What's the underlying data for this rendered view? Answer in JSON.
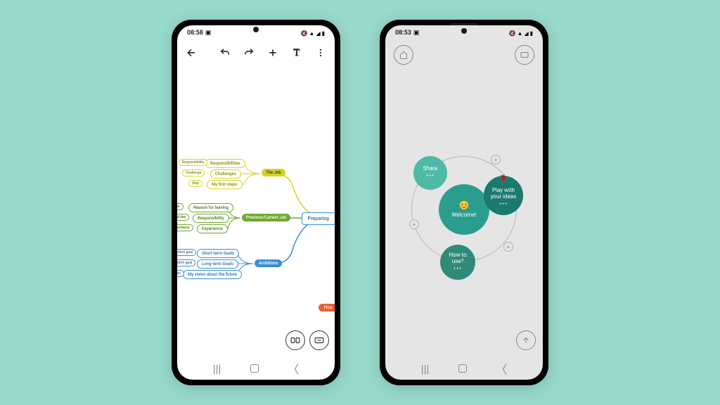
{
  "phoneLeft": {
    "status": {
      "time": "08:58",
      "indicators": "📷",
      "right": "🔇 📶 📶 🔋"
    },
    "mindmap": {
      "main": "Preparing",
      "branchYellow": {
        "title": "The Job",
        "children": [
          "Responsibilities",
          "Challenges",
          "My first steps"
        ],
        "leaves": [
          "Responsibility",
          "Challenge",
          "Step"
        ]
      },
      "branchGreen": {
        "title": "Previous/Current Job",
        "children": [
          "Reason for leaving",
          "Responsibility",
          "Experience"
        ],
        "leaves": [
          "Reason",
          "Typical day",
          "Experience"
        ]
      },
      "branchBlue": {
        "title": "Ambitions",
        "children": [
          "Short-term Goals",
          "Long-term Goals",
          "My vision about the future"
        ],
        "leaves": [
          "Short-term goal",
          "Long-term goal",
          "Vision"
        ]
      },
      "orangeTag": "Fina"
    }
  },
  "phoneRight": {
    "status": {
      "time": "08:53",
      "indicators": "📷",
      "right": "🔇 📶 📶 🔋"
    },
    "bubbles": {
      "center": "Welcome!",
      "emoji": "😊",
      "share": "Share",
      "play1": "Play with",
      "play2": "your ideas",
      "how1": "How to",
      "how2": "use?"
    }
  }
}
